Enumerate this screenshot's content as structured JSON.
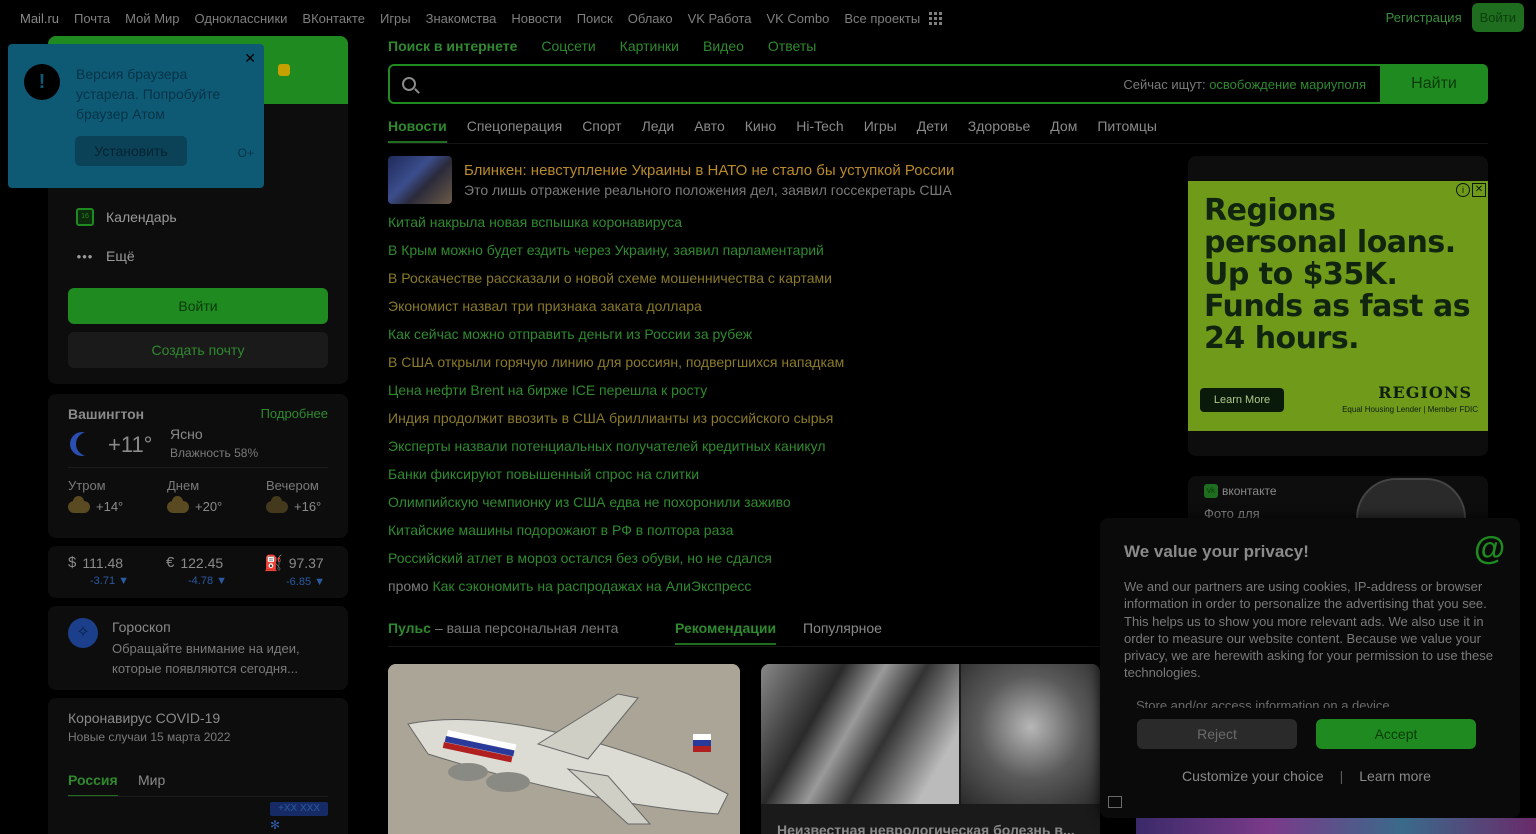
{
  "topnav": {
    "items": [
      "Mail.ru",
      "Почта",
      "Мой Мир",
      "Одноклассники",
      "ВКонтакте",
      "Игры",
      "Знакомства",
      "Новости",
      "Поиск",
      "Облако",
      "VK Работа",
      "VK Combo",
      "Все проекты"
    ],
    "register": "Регистрация",
    "login": "Войти"
  },
  "popup": {
    "text": "Версия браузера устарела. Попробуйте браузер Атом",
    "install": "Установить"
  },
  "mail": {
    "calendar": "Календарь",
    "more": "Ещё",
    "login": "Войти",
    "create": "Создать почту"
  },
  "weather": {
    "city": "Вашингтон",
    "more": "Подробнее",
    "temp": "+11°",
    "condition": "Ясно",
    "humidity": "Влажность 58%",
    "parts": [
      {
        "label": "Утром",
        "temp": "+14°"
      },
      {
        "label": "Днем",
        "temp": "+20°"
      },
      {
        "label": "Вечером",
        "temp": "+16°"
      }
    ]
  },
  "fx": [
    {
      "symbol": "$",
      "value": "111.48",
      "change": "-3.71 ▼"
    },
    {
      "symbol": "€",
      "value": "122.45",
      "change": "-4.78 ▼"
    },
    {
      "symbol": "⛽",
      "value": "97.37",
      "change": "-6.85 ▼"
    }
  ],
  "horoscope": {
    "title": "Гороскоп",
    "text": "Обращайте внимание на идеи, которые появляются сегодня..."
  },
  "covid": {
    "title": "Коронавирус COVID-19",
    "subtitle": "Новые случаи 15 марта 2022",
    "tab_active": "Россия",
    "tab_other": "Мир",
    "badge": "+XX XXX"
  },
  "search": {
    "tabs": [
      "Поиск в интернете",
      "Соцсети",
      "Картинки",
      "Видео",
      "Ответы"
    ],
    "hint_prefix": "Сейчас ищут:",
    "hint_query": "освобождение мариуполя",
    "button": "Найти"
  },
  "news": {
    "tabs": [
      "Новости",
      "Спецоперация",
      "Спорт",
      "Леди",
      "Авто",
      "Кино",
      "Hi-Tech",
      "Игры",
      "Дети",
      "Здоровье",
      "Дом",
      "Питомцы"
    ],
    "main_title": "Блинкен: невступление Украины в НАТО не стало бы уступкой России",
    "main_sub": "Это лишь отражение реального положения дел, заявил госсекретарь США",
    "items": [
      {
        "text": "Китай накрыла новая вспышка коронавируса",
        "tone": "g"
      },
      {
        "text": "В Крым можно будет ездить через Украину, заявил парламентарий",
        "tone": "g"
      },
      {
        "text": "В Роскачестве рассказали о новой схеме мошенничества с картами",
        "tone": "y"
      },
      {
        "text": "Экономист назвал три признака заката доллара",
        "tone": "y"
      },
      {
        "text": "Как сейчас можно отправить деньги из России за рубеж",
        "tone": "g"
      },
      {
        "text": "В США открыли горячую линию для россиян, подвергшихся нападкам",
        "tone": "y"
      },
      {
        "text": "Цена нефти Brent на бирже ICE перешла к росту",
        "tone": "g"
      },
      {
        "text": "Индия продолжит ввозить в США бриллианты из российского сырья",
        "tone": "y"
      },
      {
        "text": "Эксперты назвали потенциальных получателей кредитных каникул",
        "tone": "g"
      },
      {
        "text": "Банки фиксируют повышенный спрос на слитки",
        "tone": "g"
      },
      {
        "text": "Олимпийскую чемпионку из США едва не похоронили заживо",
        "tone": "g"
      },
      {
        "text": "Китайские машины подорожают в РФ в полтора раза",
        "tone": "g"
      },
      {
        "text": "Российский атлет в мороз остался без обуви, но не сдался",
        "tone": "g"
      }
    ],
    "promo_tag": "промо",
    "promo_text": "Как сэкономить на распродажах на АлиЭкспресс"
  },
  "pulse": {
    "title": "Пульс",
    "desc": "– ваша персональная лента",
    "tab_recommend": "Рекомендации",
    "tab_popular": "Популярное",
    "card2_caption": "Неизвестная неврологическая болезнь в..."
  },
  "ad": {
    "title": "Regions personal loans. Up to $35K. Funds as fast as 24 hours.",
    "button": "Learn More",
    "brand": "REGIONS",
    "brand_sub": "Equal Housing Lender | Member FDIC"
  },
  "vk": {
    "logo": "вконтакте",
    "text": "Фото для"
  },
  "privacy": {
    "title": "We value your privacy!",
    "text": "We and our partners are using cookies, IP-address or browser information in order to personalize the advertising that you see. This helps us to show you more relevant ads. We also use it in order to measure our website content. Because we value your privacy, we are herewith asking for your permission to use these technologies.",
    "store": "Store and/or access information on a device",
    "reject": "Reject",
    "accept": "Accept",
    "customize": "Customize your choice",
    "learn": "Learn more"
  }
}
